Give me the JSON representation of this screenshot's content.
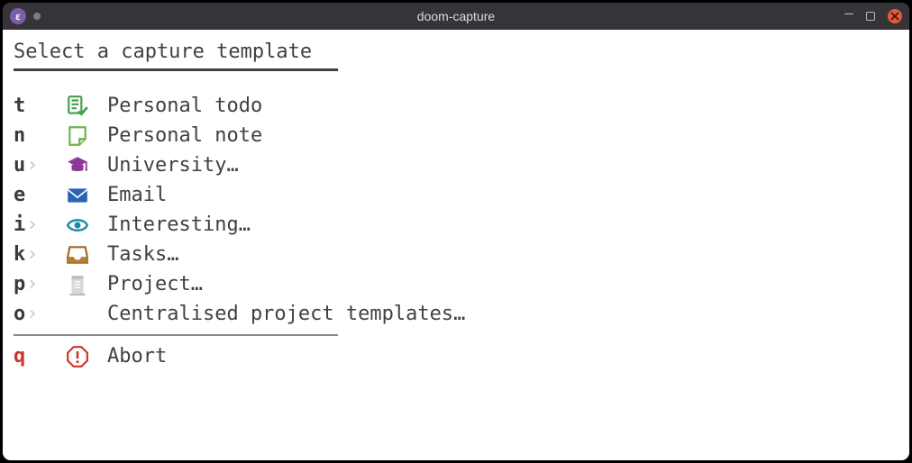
{
  "window": {
    "title": "doom-capture"
  },
  "heading": "Select a capture template",
  "items": [
    {
      "key": "t",
      "expand": false,
      "icon": "todo-check-icon",
      "label": "Personal todo"
    },
    {
      "key": "n",
      "expand": false,
      "icon": "note-icon",
      "label": "Personal note"
    },
    {
      "key": "u",
      "expand": true,
      "icon": "graduation-icon",
      "label": "University…"
    },
    {
      "key": "e",
      "expand": false,
      "icon": "envelope-icon",
      "label": "Email"
    },
    {
      "key": "i",
      "expand": true,
      "icon": "eye-icon",
      "label": "Interesting…"
    },
    {
      "key": "k",
      "expand": true,
      "icon": "inbox-icon",
      "label": "Tasks…"
    },
    {
      "key": "p",
      "expand": true,
      "icon": "project-icon",
      "label": "Project…"
    },
    {
      "key": "o",
      "expand": true,
      "icon": "",
      "label": "Centralised project templates…"
    }
  ],
  "abort": {
    "key": "q",
    "icon": "alert-octagon-icon",
    "label": "Abort"
  }
}
